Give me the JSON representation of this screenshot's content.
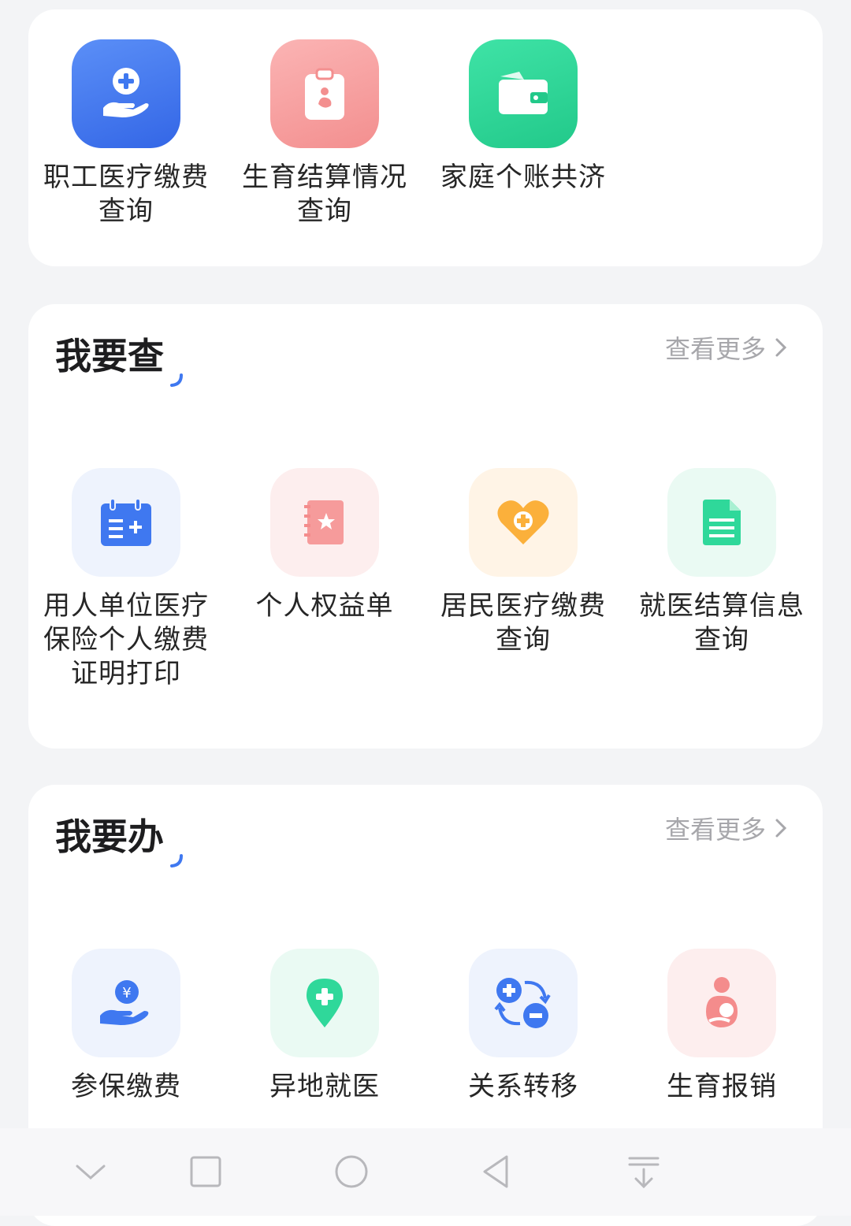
{
  "top_grid": {
    "items": [
      {
        "label": "职工医疗缴费\n查询",
        "icon": "hand-plus-icon"
      },
      {
        "label": "生育结算情况\n查询",
        "icon": "clipboard-baby-icon"
      },
      {
        "label": "家庭个账共济",
        "icon": "wallet-icon"
      }
    ]
  },
  "check_section": {
    "title": "我要查",
    "more_label": "查看更多",
    "items": [
      {
        "label": "用人单位医疗\n保险个人缴费\n证明打印",
        "icon": "calendar-plus-icon"
      },
      {
        "label": "个人权益单",
        "icon": "notebook-star-icon"
      },
      {
        "label": "居民医疗缴费\n查询",
        "icon": "heart-plus-icon"
      },
      {
        "label": "就医结算信息\n查询",
        "icon": "document-icon"
      }
    ]
  },
  "do_section": {
    "title": "我要办",
    "more_label": "查看更多",
    "items": [
      {
        "label": "参保缴费",
        "icon": "hand-yuan-icon"
      },
      {
        "label": "异地就医",
        "icon": "location-plus-icon"
      },
      {
        "label": "关系转移",
        "icon": "transfer-icon"
      },
      {
        "label": "生育报销",
        "icon": "mother-baby-icon"
      }
    ]
  },
  "colors": {
    "accent_blue": "#3f78f0",
    "pink": "#f7a3a3",
    "green": "#2fd89a"
  }
}
